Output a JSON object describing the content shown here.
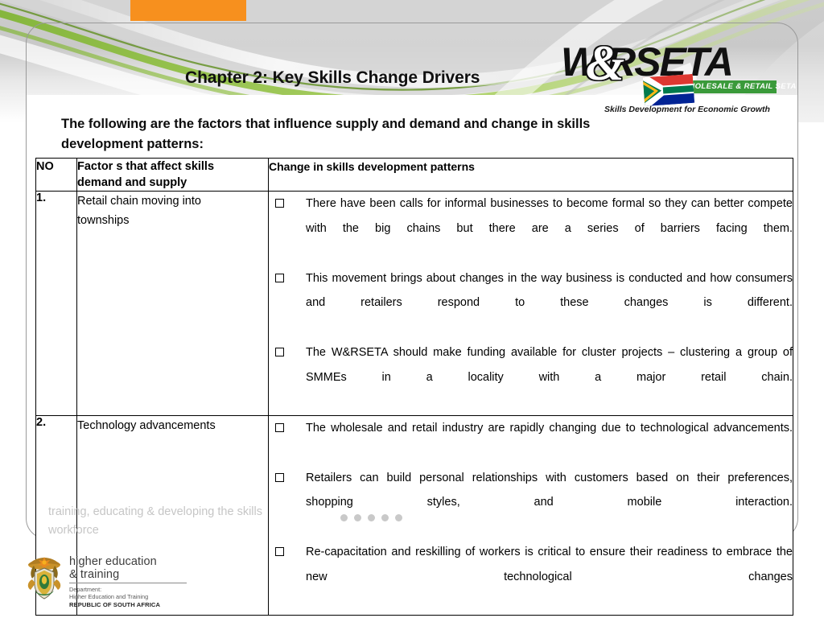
{
  "slide": {
    "title": "Chapter 2: Key Skills Change Drivers",
    "intro_line1": "The following are the factors that influence supply and demand and change in skills",
    "intro_line2": "development  patterns:",
    "accent_orange": "#f7901e",
    "accent_green": "#8cc63f"
  },
  "logo": {
    "word": "W   RSETA",
    "ampersand": "&",
    "strip": "WHOLESALE & RETAIL SETA",
    "tagline": "Skills Development for Economic Growth"
  },
  "table": {
    "headers": {
      "no": "NO",
      "factor_line1": "Factor  s  that  affect  skills",
      "factor_line2": "demand and supply",
      "change": "Change in skills development patterns"
    },
    "rows": [
      {
        "no": "1.",
        "factor_line1": "Retail    chain    moving    into",
        "factor_line2": "townships",
        "bullets": [
          "There have been calls for informal businesses to become formal so they can better compete with the big chains but there are a series of barriers facing them.",
          "This movement brings about changes in the way business is conducted and how consumers and retailers respond to these changes is different.",
          "The W&RSETA should make funding available for cluster projects – clustering a group of SMMEs in a locality with a major retail chain."
        ]
      },
      {
        "no": "2.",
        "factor_line1": "Technology advancements",
        "factor_line2": "",
        "bullets": [
          "The wholesale and retail industry are rapidly changing due to technological advancements.",
          "Retailers can build personal relationships with customers based on their preferences, shopping styles, and mobile interaction.",
          "Re-capacitation and reskilling of workers is critical to ensure their readiness to embrace the new technological changes"
        ]
      }
    ]
  },
  "footer": {
    "tagline_line1": "training, educating & developing the skills",
    "tagline_line2": "workforce",
    "dots_count": 5
  },
  "dhet": {
    "line1a": "higher education",
    "line1b": "& training",
    "line2": "Department:",
    "line3": "Higher Education and Training",
    "line4": "REPUBLIC OF SOUTH AFRICA"
  }
}
